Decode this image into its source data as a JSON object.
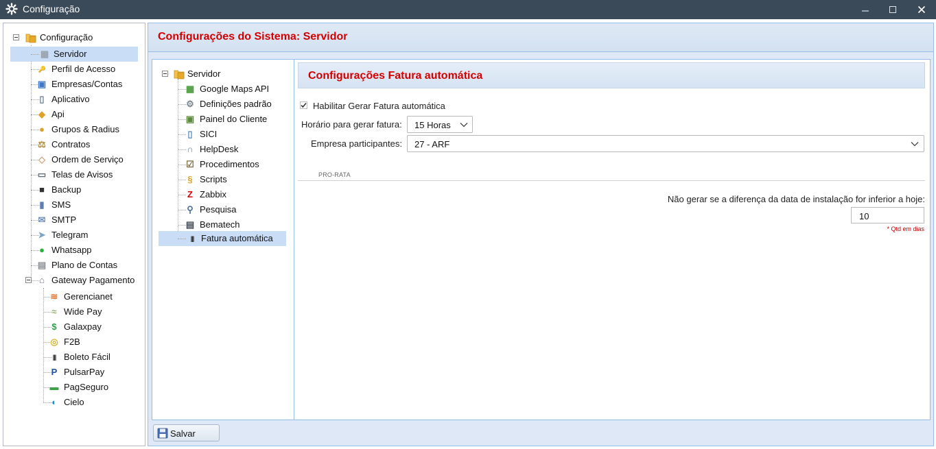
{
  "window": {
    "title": "Configuração",
    "minimize_symbol": "—",
    "maximize_symbol": "☐",
    "close_symbol": "✕"
  },
  "left_tree": {
    "root": "Configuração",
    "items": [
      {
        "label": "Servidor",
        "icon": "server-icon"
      },
      {
        "label": "Perfil de Acesso",
        "icon": "access-profile-icon"
      },
      {
        "label": "Empresas/Contas",
        "icon": "companies-icon"
      },
      {
        "label": "Aplicativo",
        "icon": "mobile-app-icon"
      },
      {
        "label": "Api",
        "icon": "api-icon"
      },
      {
        "label": "Grupos & Radius",
        "icon": "groups-icon"
      },
      {
        "label": "Contratos",
        "icon": "contracts-icon"
      },
      {
        "label": "Ordem de Serviço",
        "icon": "service-order-icon"
      },
      {
        "label": "Telas de Avisos",
        "icon": "notice-screens-icon"
      },
      {
        "label": "Backup",
        "icon": "backup-icon"
      },
      {
        "label": "SMS",
        "icon": "sms-icon"
      },
      {
        "label": "SMTP",
        "icon": "smtp-icon"
      },
      {
        "label": "Telegram",
        "icon": "telegram-icon"
      },
      {
        "label": "Whatsapp",
        "icon": "whatsapp-icon"
      },
      {
        "label": "Plano de Contas",
        "icon": "chart-of-accounts-icon"
      },
      {
        "label": "Gateway Pagamento",
        "icon": "bank-icon"
      }
    ],
    "gateways": [
      {
        "label": "Gerencianet",
        "icon": "gerencianet-icon"
      },
      {
        "label": "Wide Pay",
        "icon": "widepay-icon"
      },
      {
        "label": "Galaxpay",
        "icon": "galaxpay-icon"
      },
      {
        "label": "F2B",
        "icon": "f2b-icon"
      },
      {
        "label": "Boleto Fácil",
        "icon": "barcode-icon"
      },
      {
        "label": "PulsarPay",
        "icon": "pulsarpay-icon"
      },
      {
        "label": "PagSeguro",
        "icon": "pagseguro-icon"
      },
      {
        "label": "Cielo",
        "icon": "cielo-icon"
      }
    ]
  },
  "main": {
    "title": "Configurações do Sistema: Servidor",
    "sub_tree": {
      "root": "Servidor",
      "items": [
        {
          "label": "Google Maps API",
          "icon": "map-icon"
        },
        {
          "label": "Definições padrão",
          "icon": "gear-icon"
        },
        {
          "label": "Painel do Cliente",
          "icon": "client-panel-icon"
        },
        {
          "label": "SICI",
          "icon": "document-icon"
        },
        {
          "label": "HelpDesk",
          "icon": "headset-icon"
        },
        {
          "label": "Procedimentos",
          "icon": "checklist-icon"
        },
        {
          "label": "Scripts",
          "icon": "script-icon"
        },
        {
          "label": "Zabbix",
          "icon": "zabbix-icon"
        },
        {
          "label": "Pesquisa",
          "icon": "search-icon"
        },
        {
          "label": "Bematech",
          "icon": "printer-icon"
        },
        {
          "label": "Fatura automática",
          "icon": "barcode-icon"
        }
      ]
    },
    "form": {
      "title": "Configurações Fatura automática",
      "enable_label": "Habilitar Gerar Fatura automática",
      "enable_checked": true,
      "time_label": "Horário para gerar fatura:",
      "time_value": "15 Horas",
      "company_label": "Empresa participantes:",
      "company_value": "27 - ARF",
      "section_title": "PRO-RATA",
      "prorata_label": "Não gerar se a diferença da data de instalação for inferior a hoje:",
      "prorata_value": "10",
      "prorata_hint": "* Qtd em dias"
    },
    "save_label": "Salvar"
  },
  "colors": {
    "titlebar": "#3b4a59",
    "header_red": "#d40000",
    "selection": "#c9ddf6",
    "border_blue": "#99bbe8"
  }
}
